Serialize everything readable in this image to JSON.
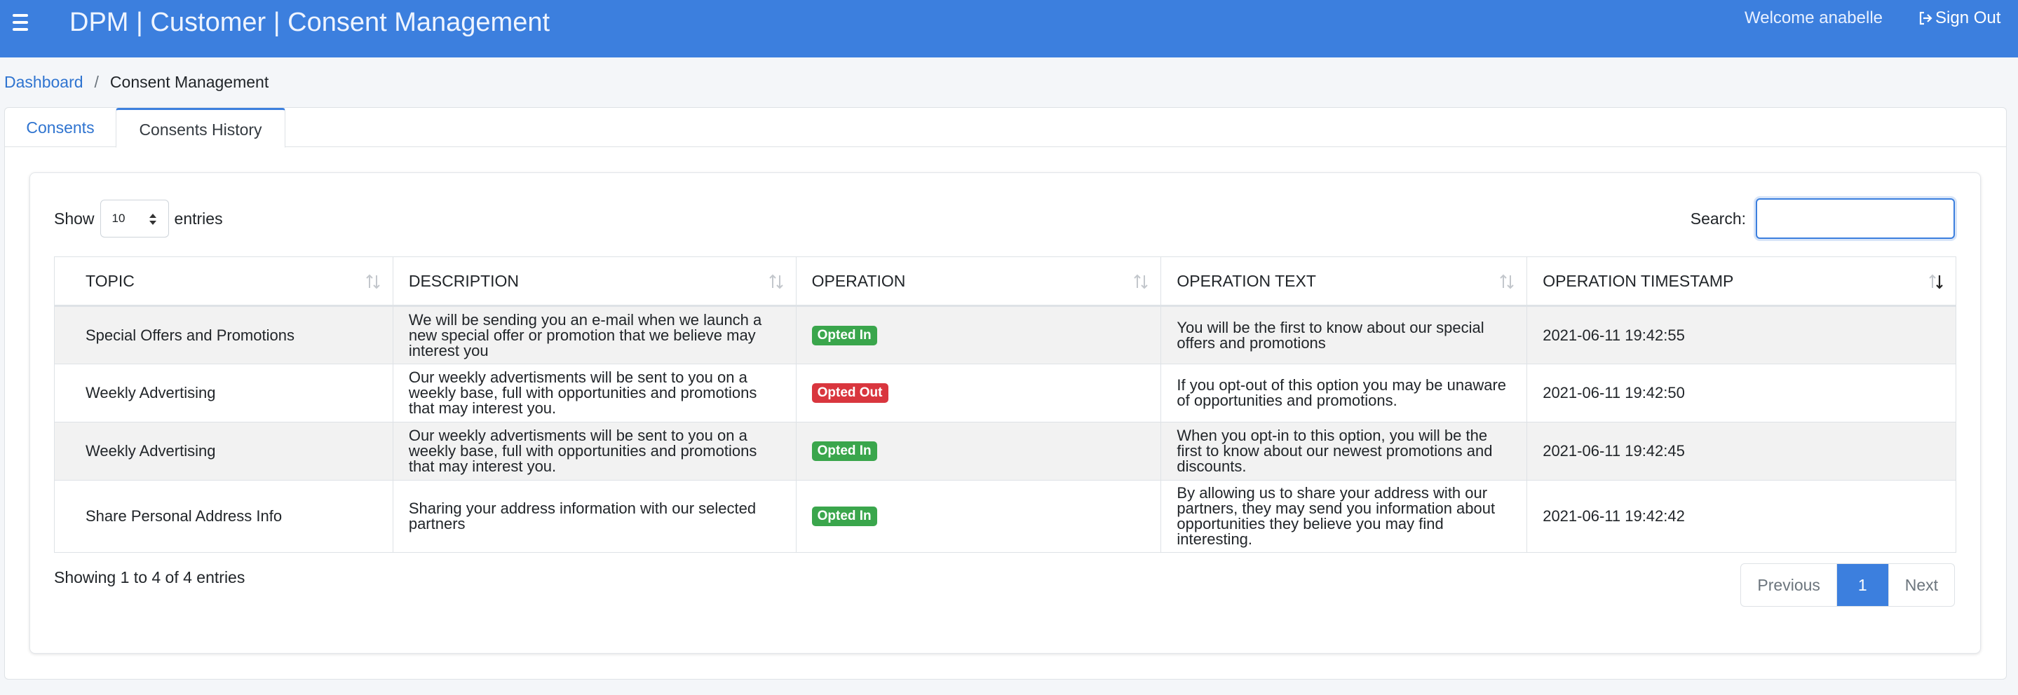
{
  "header": {
    "title": "DPM | Customer | Consent Management",
    "welcome": "Welcome anabelle",
    "signout_label": "Sign Out"
  },
  "breadcrumb": {
    "home": "Dashboard",
    "separator": "/",
    "current": "Consent Management"
  },
  "tabs": [
    {
      "label": "Consents",
      "active": false
    },
    {
      "label": "Consents History",
      "active": true
    }
  ],
  "table_controls": {
    "show_label": "Show",
    "entries_value": "10",
    "entries_label": "entries",
    "search_label": "Search:",
    "search_value": ""
  },
  "columns": [
    "TOPIC",
    "DESCRIPTION",
    "OPERATION",
    "OPERATION TEXT",
    "OPERATION TIMESTAMP"
  ],
  "rows": [
    {
      "topic": "Special Offers and Promotions",
      "description": "We will be sending you an e-mail when we launch a new special offer or promotion that we believe may interest you",
      "operation": "Opted In",
      "operation_text": "You will be the first to know about our special offers and promotions",
      "timestamp": "2021-06-11 19:42:55"
    },
    {
      "topic": "Weekly Advertising",
      "description": "Our weekly advertisments will be sent to you on a weekly base, full with opportunities and promotions that may interest you.",
      "operation": "Opted Out",
      "operation_text": "If you opt-out of this option you may be unaware of opportunities and promotions.",
      "timestamp": "2021-06-11 19:42:50"
    },
    {
      "topic": "Weekly Advertising",
      "description": "Our weekly advertisments will be sent to you on a weekly base, full with opportunities and promotions that may interest you.",
      "operation": "Opted In",
      "operation_text": "When you opt-in to this option, you will be the first to know about our newest promotions and discounts.",
      "timestamp": "2021-06-11 19:42:45"
    },
    {
      "topic": "Share Personal Address Info",
      "description": "Sharing your address information with our selected partners",
      "operation": "Opted In",
      "operation_text": "By allowing us to share your address with our partners, they may send you information about opportunities they believe you may find interesting.",
      "timestamp": "2021-06-11 19:42:42"
    }
  ],
  "footer": {
    "info": "Showing 1 to 4 of 4 entries",
    "previous": "Previous",
    "page": "1",
    "next": "Next"
  },
  "colors": {
    "header_bg": "#3c7fde",
    "opted_in": "#3aa64c",
    "opted_out": "#d9363e",
    "link": "#2f74d0"
  }
}
